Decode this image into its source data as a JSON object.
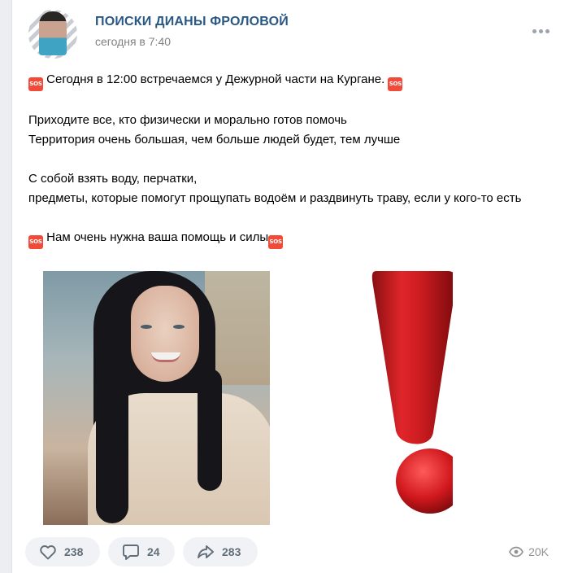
{
  "post": {
    "group_name": "ПОИСКИ ДИАНЫ ФРОЛОВОЙ",
    "time": "сегодня в 7:40",
    "sos_label": "SOS",
    "lines": {
      "l1": "Сегодня в 12:00 встречаемся у Дежурной части на Кургане.",
      "l2": "Приходите все, кто физически и морально готов помочь",
      "l3": "Территория очень большая, чем больше людей будет, тем лучше",
      "l4": "С собой взять воду, перчатки,",
      "l5": "предметы, которые помогут прощупать водоём и раздвинуть траву, если у кого-то есть",
      "l6": "Нам очень нужна ваша помощь и силы"
    }
  },
  "actions": {
    "likes": "238",
    "comments": "24",
    "shares": "283",
    "views": "20K"
  },
  "icons": {
    "more": "more-dots-icon",
    "like": "heart-icon",
    "comment": "comment-icon",
    "share": "share-arrow-icon",
    "views": "eye-icon",
    "sos": "sos-emoji-icon"
  },
  "colors": {
    "link": "#2a5885",
    "sos_red": "#f24a39",
    "action_bg": "#f0f2f5",
    "action_text": "#626d7a"
  }
}
